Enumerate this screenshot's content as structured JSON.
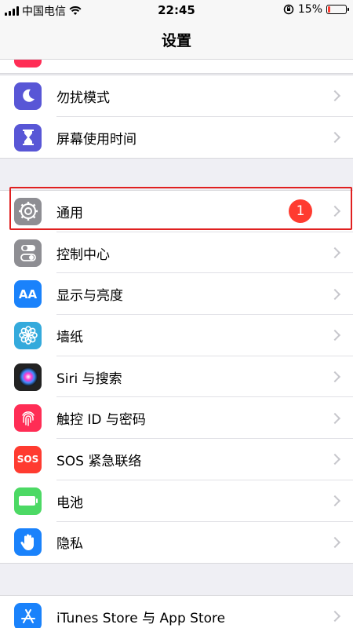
{
  "status_bar": {
    "carrier": "中国电信",
    "time": "22:45",
    "battery_percent": "15%",
    "battery_level": 0.15
  },
  "nav": {
    "title": "设置"
  },
  "groups": [
    {
      "items": [
        {
          "label": "勿扰模式",
          "icon": "moon-icon",
          "color": "#5856d6"
        },
        {
          "label": "屏幕使用时间",
          "icon": "hourglass-icon",
          "color": "#5856d6"
        }
      ]
    },
    {
      "items": [
        {
          "label": "通用",
          "icon": "gear-icon",
          "color": "#8e8e93",
          "badge": "1"
        },
        {
          "label": "控制中心",
          "icon": "toggle-icon",
          "color": "#8e8e93"
        },
        {
          "label": "显示与亮度",
          "icon": "text-size-icon",
          "color": "#1a82fb",
          "icon_text": "AA"
        },
        {
          "label": "墙纸",
          "icon": "flower-icon",
          "color": "#34aadc"
        },
        {
          "label": "Siri 与搜索",
          "icon": "siri-icon",
          "color": "#222222"
        },
        {
          "label": "触控 ID 与密码",
          "icon": "fingerprint-icon",
          "color": "#ff2d55"
        },
        {
          "label": "SOS 紧急联络",
          "icon": "sos-icon",
          "color": "#ff3b30",
          "icon_text": "SOS"
        },
        {
          "label": "电池",
          "icon": "battery-icon",
          "color": "#4cd964"
        },
        {
          "label": "隐私",
          "icon": "hand-icon",
          "color": "#1a82fb"
        }
      ]
    },
    {
      "items": [
        {
          "label": "iTunes Store 与 App Store",
          "icon": "app-store-icon",
          "color": "#1a82fb"
        }
      ]
    }
  ]
}
